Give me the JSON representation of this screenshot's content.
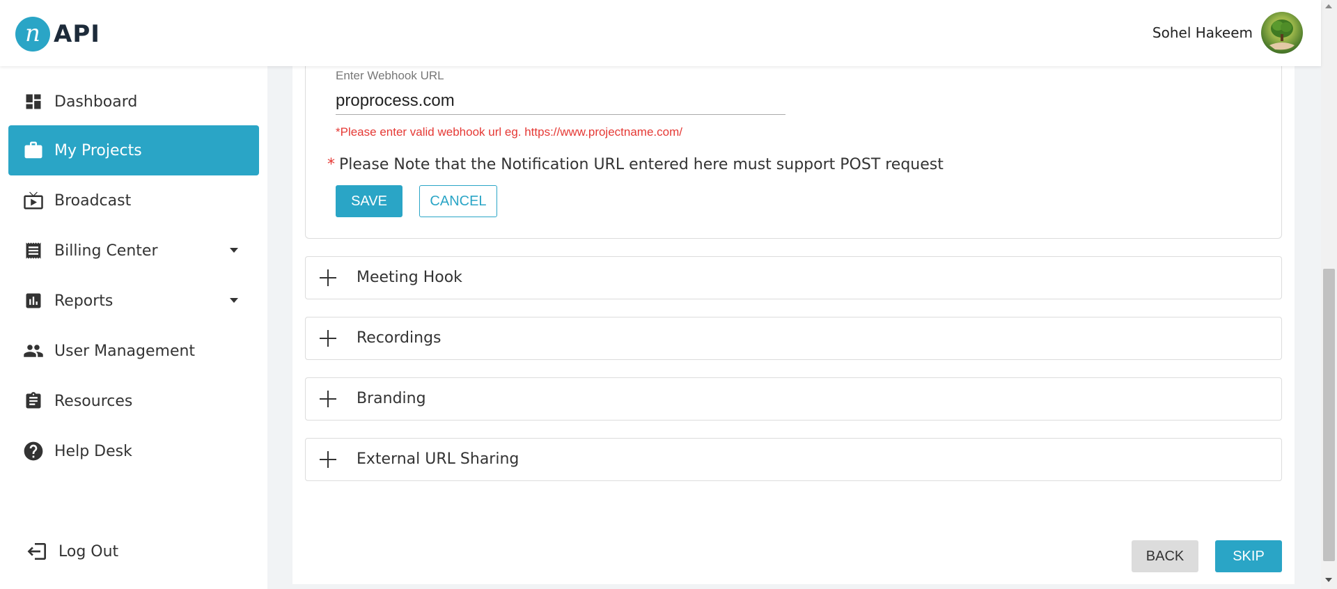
{
  "app": {
    "logo_letter": "n",
    "logo_text": "API"
  },
  "header": {
    "user_name": "Sohel Hakeem"
  },
  "sidebar": {
    "items": [
      {
        "label": "Dashboard",
        "icon": "dashboard-icon"
      },
      {
        "label": "My Projects",
        "icon": "briefcase-icon",
        "active": true
      },
      {
        "label": "Broadcast",
        "icon": "broadcast-icon"
      },
      {
        "label": "Billing Center",
        "icon": "receipt-icon",
        "has_dropdown": true
      },
      {
        "label": "Reports",
        "icon": "bar-chart-icon",
        "has_dropdown": true
      },
      {
        "label": "User Management",
        "icon": "users-icon"
      },
      {
        "label": "Resources",
        "icon": "clipboard-icon"
      },
      {
        "label": "Help Desk",
        "icon": "help-icon"
      }
    ],
    "logout_label": "Log Out"
  },
  "webhook": {
    "field_label": "Enter Webhook URL",
    "value": "proprocess.com",
    "error": "*Please enter valid webhook url eg. https://www.projectname.com/",
    "note_star": "*",
    "note": "Please Note that the Notification URL entered here must support POST request",
    "save_label": "SAVE",
    "cancel_label": "CANCEL"
  },
  "accordions": [
    {
      "label": "Meeting Hook"
    },
    {
      "label": "Recordings"
    },
    {
      "label": "Branding"
    },
    {
      "label": "External URL Sharing"
    }
  ],
  "footer": {
    "back_label": "BACK",
    "skip_label": "SKIP"
  },
  "colors": {
    "accent": "#2aa5c6",
    "error": "#e53935",
    "text": "#333333"
  }
}
